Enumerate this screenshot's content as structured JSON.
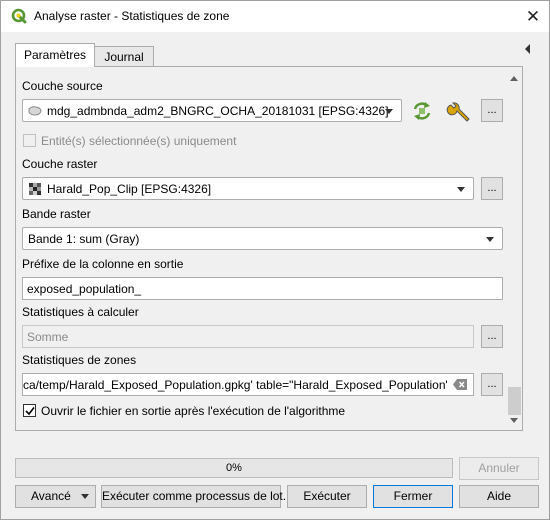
{
  "window": {
    "title": "Analyse raster - Statistiques de zone",
    "close_icon": "close-icon",
    "colors": {
      "qgis_green": "#589632",
      "link_blue": "#0078d7"
    }
  },
  "tabs": [
    {
      "label": "Paramètres",
      "active": true
    },
    {
      "label": "Journal",
      "active": false
    }
  ],
  "params": {
    "source_layer": {
      "label": "Couche source",
      "value": "mdg_admbnda_adm2_BNGRC_OCHA_20181031 [EPSG:4326]",
      "icon": "polygon-layer-icon"
    },
    "selected_only": {
      "label": "Entité(s) sélectionnée(s) uniquement",
      "checked": false,
      "enabled": false
    },
    "raster_layer": {
      "label": "Couche raster",
      "value": "Harald_Pop_Clip [EPSG:4326]",
      "icon": "raster-layer-icon"
    },
    "raster_band": {
      "label": "Bande raster",
      "value": "Bande 1: sum (Gray)"
    },
    "prefix": {
      "label": "Préfixe de la colonne en sortie",
      "value": "exposed_population_"
    },
    "stats": {
      "label": "Statistiques à calculer",
      "value": "Somme"
    },
    "zones": {
      "label": "Statistiques de zones",
      "value": "ca/temp/Harald_Exposed_Population.gpkg' table=\"Harald_Exposed_Population\" (geom)"
    },
    "open_output": {
      "label": "Ouvrir le fichier en sortie après l'exécution de l'algorithme",
      "checked": true
    },
    "dots_label": "..."
  },
  "progress": {
    "text": "0%",
    "value": 0
  },
  "buttons": {
    "cancel": "Annuler",
    "advanced": "Avancé",
    "batch": "Exécuter comme processus de lot...",
    "run": "Exécuter",
    "close": "Fermer",
    "help": "Aide"
  }
}
